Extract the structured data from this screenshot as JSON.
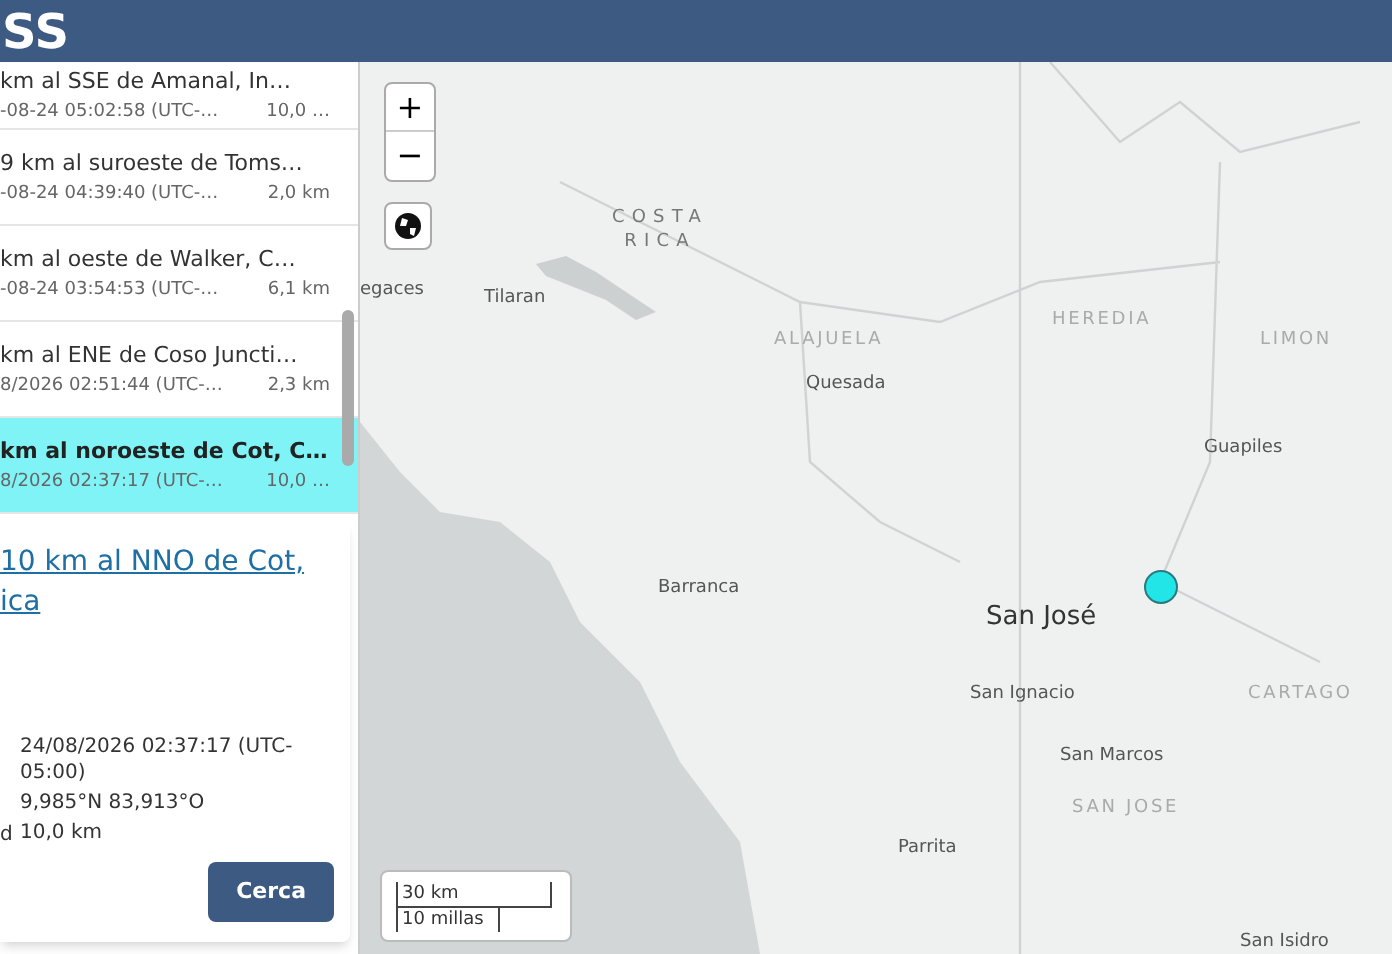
{
  "header": {
    "title": "SS"
  },
  "events": [
    {
      "title": "km al SSE de Amanal, In…",
      "time": "-08-24 05:02:58 (UTC-…",
      "depth": "10,0 …",
      "selected": false
    },
    {
      "title": "9 km al suroeste de Toms…",
      "time": "-08-24 04:39:40 (UTC-…",
      "depth": "2,0 km",
      "selected": false
    },
    {
      "title": "km al oeste de Walker, C…",
      "time": "-08-24 03:54:53 (UTC-…",
      "depth": "6,1 km",
      "selected": false
    },
    {
      "title": "km al ENE de Coso Juncti…",
      "time": "8/2026 02:51:44 (UTC-…",
      "depth": "2,3 km",
      "selected": false
    },
    {
      "title": "km al noroeste de Cot, C…",
      "time": "8/2026 02:37:17 (UTC-…",
      "depth": "10,0 …",
      "selected": true
    }
  ],
  "popup": {
    "title": "10 km al NNO de Cot, ica",
    "details": [
      {
        "value": "24/08/2026 02:37:17 (UTC-05:00)"
      },
      {
        "value": "9,985°N 83,913°O"
      },
      {
        "label": "d",
        "value": "10,0 km"
      }
    ],
    "button": "Cerca"
  },
  "map": {
    "zoom_in": "+",
    "zoom_out": "−",
    "labels": [
      {
        "text": "COSTA RICA",
        "kind": "country"
      },
      {
        "text": "egaces",
        "kind": "city"
      },
      {
        "text": "Tilaran",
        "kind": "city"
      },
      {
        "text": "ALAJUELA",
        "kind": "region"
      },
      {
        "text": "HEREDIA",
        "kind": "region"
      },
      {
        "text": "LIMON",
        "kind": "region"
      },
      {
        "text": "Quesada",
        "kind": "city"
      },
      {
        "text": "Guapiles",
        "kind": "city"
      },
      {
        "text": "Barranca",
        "kind": "city"
      },
      {
        "text": "San José",
        "kind": "capital"
      },
      {
        "text": "San Ignacio",
        "kind": "city"
      },
      {
        "text": "CARTAGO",
        "kind": "region"
      },
      {
        "text": "San Marcos",
        "kind": "city"
      },
      {
        "text": "SAN JOSE",
        "kind": "region"
      },
      {
        "text": "Parrita",
        "kind": "city"
      },
      {
        "text": "San Isidro",
        "kind": "city"
      }
    ],
    "marker": {
      "color": "#22e5e8"
    },
    "scale": {
      "metric": "30 km",
      "imperial": "10 millas"
    }
  }
}
